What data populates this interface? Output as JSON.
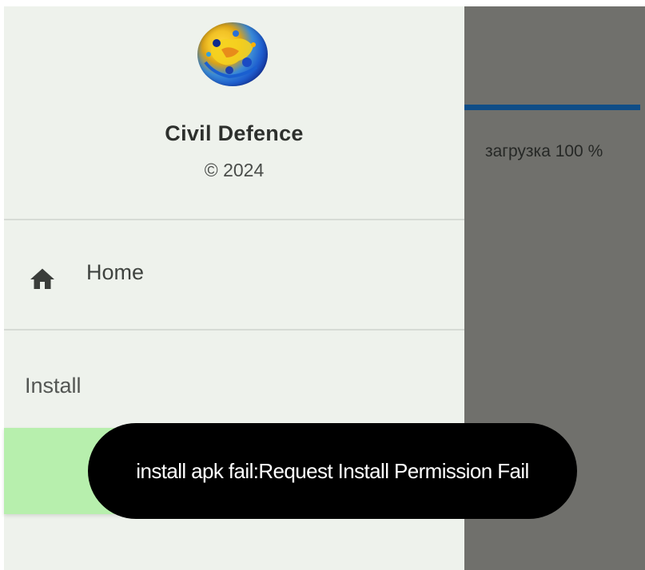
{
  "drawer": {
    "app_title": "Civil Defence",
    "copyright": "© 2024",
    "logo_icon": "globe-logo-icon",
    "items": [
      {
        "label": "Home",
        "icon": "home-icon"
      }
    ],
    "section_label": "Install",
    "install_button_label": ""
  },
  "main": {
    "progress_text": "загрузка 100 %",
    "progress_value": 1.0
  },
  "toast": {
    "message": "install apk fail:Request Install Permission Fail"
  },
  "colors": {
    "drawer_background": "#eef2ec",
    "scrim": "#70706c",
    "progress_bar": "#0f4d87",
    "install_button": "#b7efad",
    "toast_background": "#000000",
    "toast_text": "#ffffff"
  }
}
